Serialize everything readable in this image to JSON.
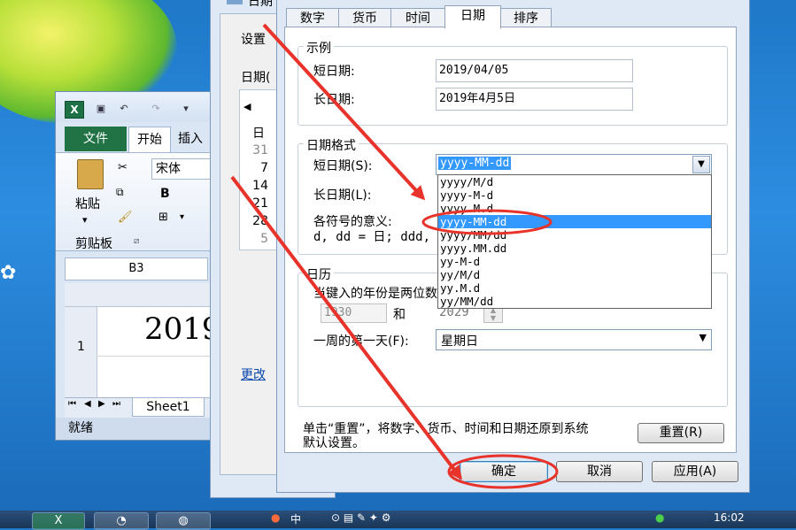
{
  "excel": {
    "tab_file": "文件",
    "tab_home": "开始",
    "tab_insert": "插入",
    "paste": "粘贴",
    "clipboard": "剪贴板",
    "font": "宋体",
    "bold": "B",
    "namebox": "B3",
    "row1": "1",
    "cell_value": "2019",
    "sheet": "Sheet1",
    "status": "就绪"
  },
  "region_dialog": {
    "title": "日期",
    "setting_label": "设置",
    "date_label": "日期(",
    "calendar_header": "日",
    "calendar_days": [
      "31",
      "7",
      "14",
      "21",
      "28",
      "5"
    ],
    "link": "更改"
  },
  "customize": {
    "tabs": [
      "数字",
      "货币",
      "时间",
      "日期",
      "排序"
    ],
    "active_tab": "日期",
    "example_group": "示例",
    "short_date_label": "短日期:",
    "short_date_value": "2019/04/05",
    "long_date_label": "长日期:",
    "long_date_value": "2019年4月5日",
    "format_group": "日期格式",
    "short_format_label": "短日期(S):",
    "short_format_value": "yyyy-MM-dd",
    "long_format_label": "长日期(L):",
    "meaning_label": "各符号的意义:",
    "meaning_text": "d, dd = 日;  ddd,",
    "dropdown_options": [
      "yyyy/M/d",
      "yyyy-M-d",
      "yyyy.M.d",
      "yyyy-MM-dd",
      "yyyy/MM/dd",
      "yyyy.MM.dd",
      "yy-M-d",
      "yy/M/d",
      "yy.M.d",
      "yy/MM/dd"
    ],
    "selected_option": "yyyy-MM-dd",
    "calendar_group": "日历",
    "two_digit_label": "当键入的年份是两位数",
    "year_from": "1930",
    "and_label": "和",
    "year_to": "2029",
    "first_day_label": "一周的第一天(F):",
    "first_day_value": "星期日",
    "reset_note_line1": "单击“重置”，将数字、货币、时间和日期还原到系统",
    "reset_note_line2": "默认设置。",
    "reset_button": "重置(R)",
    "ok_button": "确定",
    "cancel_button": "取消",
    "apply_button": "应用(A)"
  },
  "taskbar": {
    "clock": "16:02",
    "ime": "中"
  },
  "colors": {
    "annotation": "#e8332a",
    "selection": "#3399ff",
    "excel_green": "#217346"
  }
}
